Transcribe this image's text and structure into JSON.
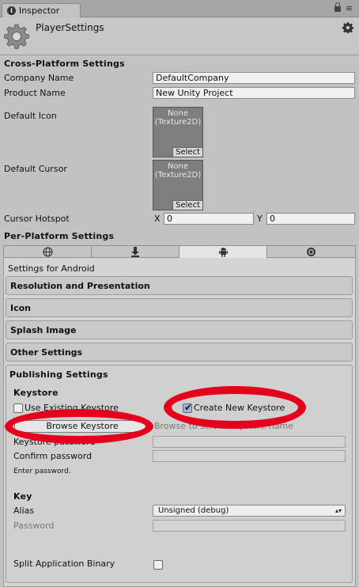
{
  "window": {
    "tab_title": "Inspector",
    "tab_icon": "i",
    "menu_glyph": "≡"
  },
  "header": {
    "title": "PlayerSettings"
  },
  "cross_platform": {
    "heading": "Cross-Platform Settings",
    "company_label": "Company Name",
    "company_value": "DefaultCompany",
    "product_label": "Product Name",
    "product_value": "New Unity Project",
    "icon_label": "Default Icon",
    "icon_none": "None",
    "icon_type": "(Texture2D)",
    "icon_select": "Select",
    "cursor_label": "Default Cursor",
    "cursor_none": "None",
    "cursor_type": "(Texture2D)",
    "cursor_select": "Select",
    "hotspot_label": "Cursor Hotspot",
    "hotspot_x_label": "X",
    "hotspot_x": "0",
    "hotspot_y_label": "Y",
    "hotspot_y": "0"
  },
  "per_platform": {
    "heading": "Per-Platform Settings",
    "platform_tabs": [
      {
        "icon": "globe-icon",
        "selected": false
      },
      {
        "icon": "download-icon",
        "selected": false
      },
      {
        "icon": "android-icon",
        "selected": true
      },
      {
        "icon": "circle-icon",
        "selected": false
      }
    ],
    "settings_for": "Settings for Android",
    "sections": [
      "Resolution and Presentation",
      "Icon",
      "Splash Image",
      "Other Settings"
    ]
  },
  "publishing": {
    "heading": "Publishing Settings",
    "keystore_heading": "Keystore",
    "use_existing_label": "Use Existing Keystore",
    "use_existing_checked": false,
    "create_new_label": "Create New Keystore",
    "create_new_checked": true,
    "browse_button": "Browse Keystore",
    "browse_hint": "Browse to select keystore name",
    "keystore_password_label": "Keystore password",
    "confirm_password_label": "Confirm password",
    "enter_password_note": "Enter password.",
    "key_heading": "Key",
    "alias_label": "Alias",
    "alias_value": "Unsigned (debug)",
    "password_label": "Password",
    "split_label": "Split Application Binary",
    "split_checked": false
  },
  "colors": {
    "highlight": "#e5001b",
    "panel": "#c2c2c2"
  }
}
